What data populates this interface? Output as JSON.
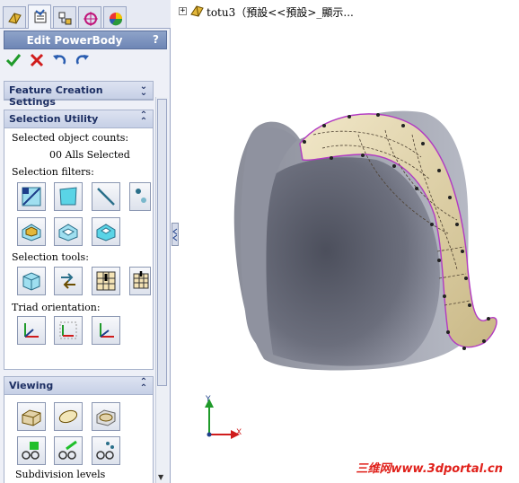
{
  "panel": {
    "title": "Edit PowerBody",
    "help_label": "?",
    "tabs": [
      "feature-manager",
      "property-manager",
      "configuration-manager",
      "dimxpert-manager",
      "display-manager"
    ]
  },
  "sections": {
    "feature_creation": {
      "header": "Feature Creation Settings"
    },
    "selection_utility": {
      "header": "Selection Utility",
      "counts_label": "Selected object counts:",
      "counts_value": "00 Alls Selected",
      "filters_label": "Selection filters:",
      "tools_label": "Selection tools:",
      "triad_label": "Triad orientation:"
    },
    "viewing": {
      "header": "Viewing",
      "subdivision_label": "Subdivision levels"
    }
  },
  "tree": {
    "expander": "+",
    "root_text": "totu3（預設<<預設>_顯示..."
  },
  "triad": {
    "y": "Y",
    "x": "X"
  },
  "watermark": "三维网www.3dportal.cn",
  "colors": {
    "panel_title_bg": "#7a90bf",
    "section_header_text": "#1d2f63",
    "model_gray": "#6e7180",
    "body_tan": "#e2d2a8",
    "watermark": "#e0201a"
  }
}
